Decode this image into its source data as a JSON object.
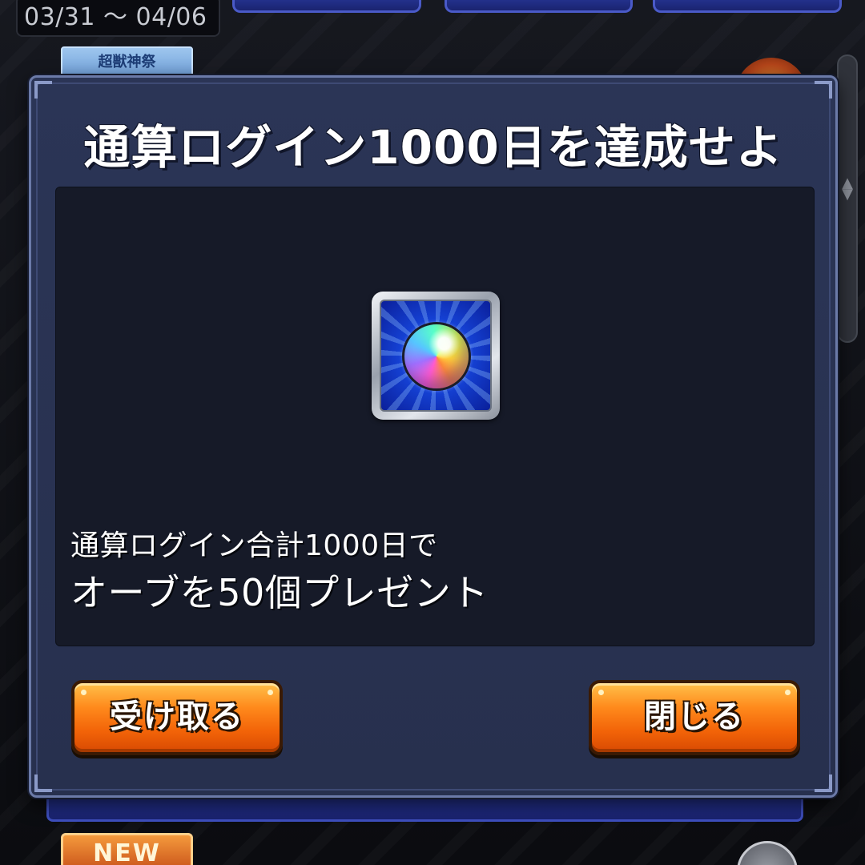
{
  "background": {
    "date_range": "03/31 ～ 04/06",
    "badge_text": "超獣神祭",
    "new_badge": "NEW",
    "scroll_arrows": "▲\n▼"
  },
  "modal": {
    "title": "通算ログイン1000日を達成せよ",
    "reward_icon": "rainbow-orb-icon",
    "description_line1": "通算ログイン合計1000日で",
    "description_line2": "オーブを50個プレゼント",
    "receive_button": "受け取る",
    "close_button": "閉じる"
  },
  "colors": {
    "modal_bg": "#2b3556",
    "panel_bg": "#161a28",
    "button_orange": "#f26308",
    "title_text": "#ffffff"
  }
}
